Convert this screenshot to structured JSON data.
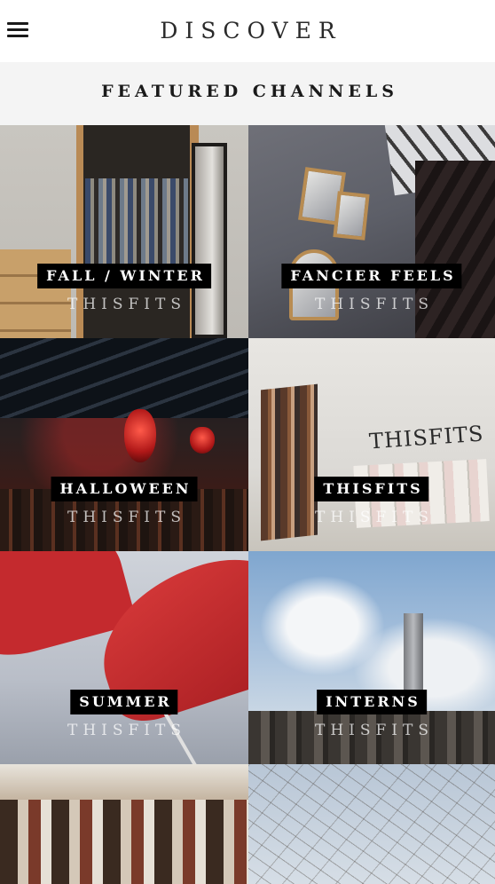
{
  "header": {
    "title": "DISCOVER",
    "menu_icon": "hamburger-menu-icon"
  },
  "section": {
    "title": "FEATURED CHANNELS"
  },
  "channels": [
    {
      "name": "FALL / WINTER",
      "brand": "THISFITS"
    },
    {
      "name": "FANCIER FEELS",
      "brand": "THISFITS"
    },
    {
      "name": "HALLOWEEN",
      "brand": "THISFITS"
    },
    {
      "name": "THISFITS",
      "brand": "THISFITS"
    },
    {
      "name": "SUMMER",
      "brand": "THISFITS"
    },
    {
      "name": "INTERNS",
      "brand": "THISFITS"
    },
    {
      "name": "",
      "brand": ""
    },
    {
      "name": "",
      "brand": ""
    }
  ],
  "scene_text": {
    "office_wall": "THISFITS"
  },
  "colors": {
    "label_bg": "#000000",
    "label_text": "#ffffff",
    "section_bg": "#f4f4f4"
  }
}
